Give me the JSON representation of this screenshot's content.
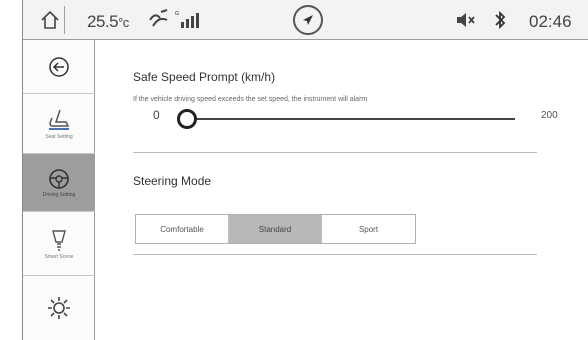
{
  "statusbar": {
    "temperature": "25.5",
    "temperature_unit": "°c",
    "time": "02:46",
    "icons": [
      "home-icon",
      "wind-icon",
      "signal-icon",
      "navigation-icon",
      "mute-icon",
      "bluetooth-icon"
    ]
  },
  "sidebar": {
    "items": [
      {
        "icon": "back-icon",
        "label": ""
      },
      {
        "icon": "seat-icon",
        "label": "Seat Setting"
      },
      {
        "icon": "steering-wheel-icon",
        "label": "Driving Setting"
      },
      {
        "icon": "light-bulb-icon",
        "label": "Smart Scene"
      },
      {
        "icon": "sun-icon",
        "label": ""
      }
    ],
    "active_index": 2
  },
  "speed_prompt": {
    "title": "Safe Speed Prompt (km/h)",
    "hint": "If the vehicle driving speed exceeds the set speed, the instrument will alarm",
    "min": "0",
    "max": "200",
    "value": 0
  },
  "steering_mode": {
    "title": "Steering Mode",
    "options": [
      "Comfortable",
      "Standard",
      "Sport"
    ],
    "selected": "Standard"
  },
  "colors": {
    "active_bg": "#9d9d9d",
    "selected_bg": "#b8b8b8",
    "track": "#444444"
  }
}
